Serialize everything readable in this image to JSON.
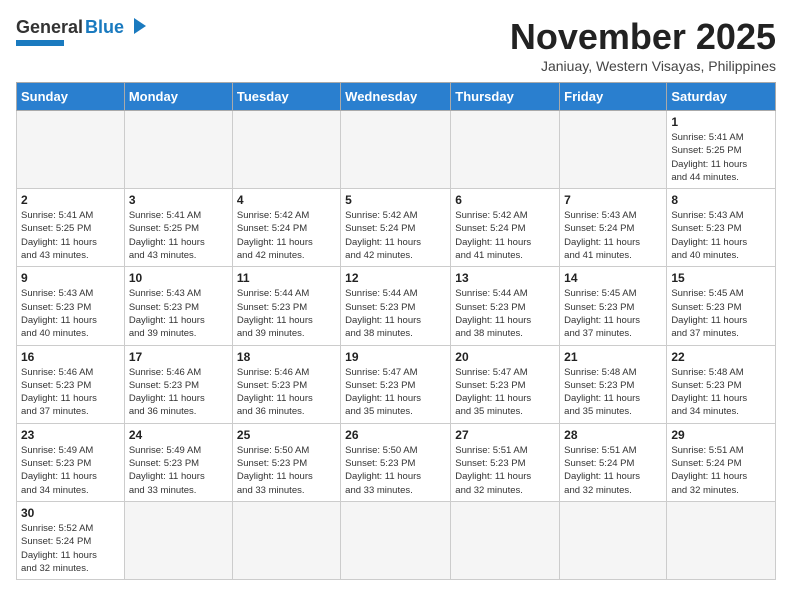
{
  "header": {
    "logo_general": "General",
    "logo_blue": "Blue",
    "month_title": "November 2025",
    "location": "Janiuay, Western Visayas, Philippines"
  },
  "weekdays": [
    "Sunday",
    "Monday",
    "Tuesday",
    "Wednesday",
    "Thursday",
    "Friday",
    "Saturday"
  ],
  "weeks": [
    [
      {
        "day": "",
        "content": ""
      },
      {
        "day": "",
        "content": ""
      },
      {
        "day": "",
        "content": ""
      },
      {
        "day": "",
        "content": ""
      },
      {
        "day": "",
        "content": ""
      },
      {
        "day": "",
        "content": ""
      },
      {
        "day": "1",
        "content": "Sunrise: 5:41 AM\nSunset: 5:25 PM\nDaylight: 11 hours\nand 44 minutes."
      }
    ],
    [
      {
        "day": "2",
        "content": "Sunrise: 5:41 AM\nSunset: 5:25 PM\nDaylight: 11 hours\nand 43 minutes."
      },
      {
        "day": "3",
        "content": "Sunrise: 5:41 AM\nSunset: 5:25 PM\nDaylight: 11 hours\nand 43 minutes."
      },
      {
        "day": "4",
        "content": "Sunrise: 5:42 AM\nSunset: 5:24 PM\nDaylight: 11 hours\nand 42 minutes."
      },
      {
        "day": "5",
        "content": "Sunrise: 5:42 AM\nSunset: 5:24 PM\nDaylight: 11 hours\nand 42 minutes."
      },
      {
        "day": "6",
        "content": "Sunrise: 5:42 AM\nSunset: 5:24 PM\nDaylight: 11 hours\nand 41 minutes."
      },
      {
        "day": "7",
        "content": "Sunrise: 5:43 AM\nSunset: 5:24 PM\nDaylight: 11 hours\nand 41 minutes."
      },
      {
        "day": "8",
        "content": "Sunrise: 5:43 AM\nSunset: 5:23 PM\nDaylight: 11 hours\nand 40 minutes."
      }
    ],
    [
      {
        "day": "9",
        "content": "Sunrise: 5:43 AM\nSunset: 5:23 PM\nDaylight: 11 hours\nand 40 minutes."
      },
      {
        "day": "10",
        "content": "Sunrise: 5:43 AM\nSunset: 5:23 PM\nDaylight: 11 hours\nand 39 minutes."
      },
      {
        "day": "11",
        "content": "Sunrise: 5:44 AM\nSunset: 5:23 PM\nDaylight: 11 hours\nand 39 minutes."
      },
      {
        "day": "12",
        "content": "Sunrise: 5:44 AM\nSunset: 5:23 PM\nDaylight: 11 hours\nand 38 minutes."
      },
      {
        "day": "13",
        "content": "Sunrise: 5:44 AM\nSunset: 5:23 PM\nDaylight: 11 hours\nand 38 minutes."
      },
      {
        "day": "14",
        "content": "Sunrise: 5:45 AM\nSunset: 5:23 PM\nDaylight: 11 hours\nand 37 minutes."
      },
      {
        "day": "15",
        "content": "Sunrise: 5:45 AM\nSunset: 5:23 PM\nDaylight: 11 hours\nand 37 minutes."
      }
    ],
    [
      {
        "day": "16",
        "content": "Sunrise: 5:46 AM\nSunset: 5:23 PM\nDaylight: 11 hours\nand 37 minutes."
      },
      {
        "day": "17",
        "content": "Sunrise: 5:46 AM\nSunset: 5:23 PM\nDaylight: 11 hours\nand 36 minutes."
      },
      {
        "day": "18",
        "content": "Sunrise: 5:46 AM\nSunset: 5:23 PM\nDaylight: 11 hours\nand 36 minutes."
      },
      {
        "day": "19",
        "content": "Sunrise: 5:47 AM\nSunset: 5:23 PM\nDaylight: 11 hours\nand 35 minutes."
      },
      {
        "day": "20",
        "content": "Sunrise: 5:47 AM\nSunset: 5:23 PM\nDaylight: 11 hours\nand 35 minutes."
      },
      {
        "day": "21",
        "content": "Sunrise: 5:48 AM\nSunset: 5:23 PM\nDaylight: 11 hours\nand 35 minutes."
      },
      {
        "day": "22",
        "content": "Sunrise: 5:48 AM\nSunset: 5:23 PM\nDaylight: 11 hours\nand 34 minutes."
      }
    ],
    [
      {
        "day": "23",
        "content": "Sunrise: 5:49 AM\nSunset: 5:23 PM\nDaylight: 11 hours\nand 34 minutes."
      },
      {
        "day": "24",
        "content": "Sunrise: 5:49 AM\nSunset: 5:23 PM\nDaylight: 11 hours\nand 33 minutes."
      },
      {
        "day": "25",
        "content": "Sunrise: 5:50 AM\nSunset: 5:23 PM\nDaylight: 11 hours\nand 33 minutes."
      },
      {
        "day": "26",
        "content": "Sunrise: 5:50 AM\nSunset: 5:23 PM\nDaylight: 11 hours\nand 33 minutes."
      },
      {
        "day": "27",
        "content": "Sunrise: 5:51 AM\nSunset: 5:23 PM\nDaylight: 11 hours\nand 32 minutes."
      },
      {
        "day": "28",
        "content": "Sunrise: 5:51 AM\nSunset: 5:24 PM\nDaylight: 11 hours\nand 32 minutes."
      },
      {
        "day": "29",
        "content": "Sunrise: 5:51 AM\nSunset: 5:24 PM\nDaylight: 11 hours\nand 32 minutes."
      }
    ],
    [
      {
        "day": "30",
        "content": "Sunrise: 5:52 AM\nSunset: 5:24 PM\nDaylight: 11 hours\nand 32 minutes."
      },
      {
        "day": "",
        "content": ""
      },
      {
        "day": "",
        "content": ""
      },
      {
        "day": "",
        "content": ""
      },
      {
        "day": "",
        "content": ""
      },
      {
        "day": "",
        "content": ""
      },
      {
        "day": "",
        "content": ""
      }
    ]
  ]
}
